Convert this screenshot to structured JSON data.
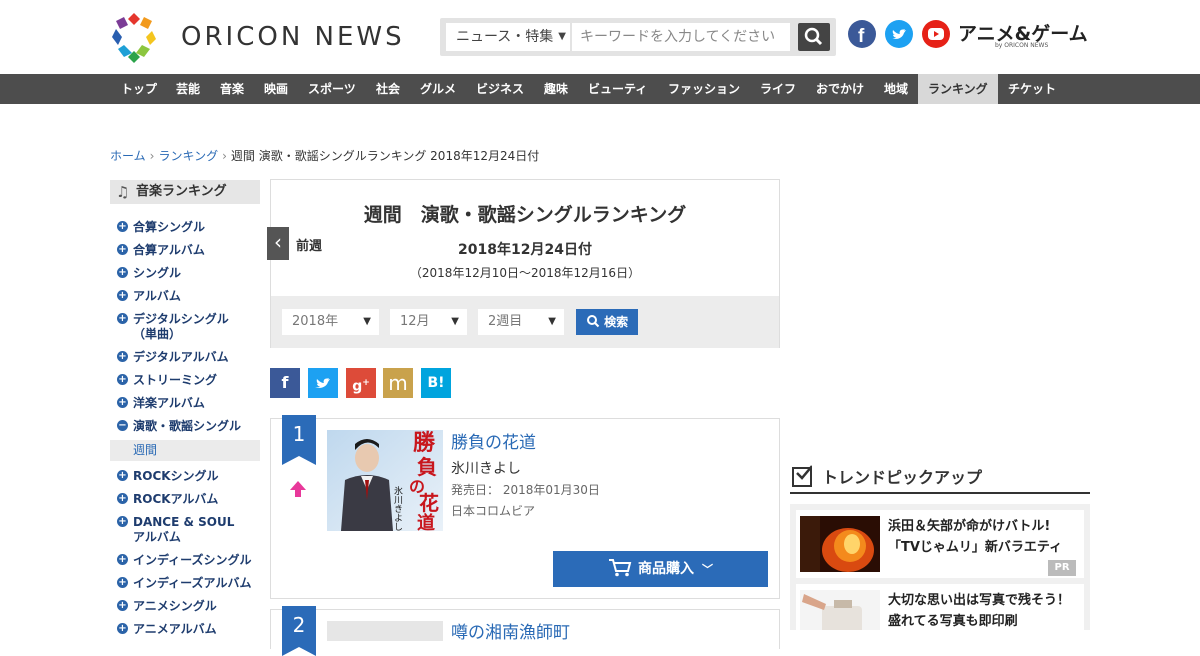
{
  "header": {
    "logo_text": "ORICON NEWS",
    "search_category": "ニュース・特集",
    "search_placeholder": "キーワードを入力してください",
    "anime_logo": "アニメ&ゲーム",
    "anime_sub": "by ORICON NEWS"
  },
  "nav": [
    "トップ",
    "芸能",
    "音楽",
    "映画",
    "スポーツ",
    "社会",
    "グルメ",
    "ビジネス",
    "趣味",
    "ビューティ",
    "ファッション",
    "ライフ",
    "おでかけ",
    "地域",
    "ランキング",
    "チケット"
  ],
  "nav_active": "ランキング",
  "breadcrumb": {
    "home": "ホーム",
    "ranking": "ランキング",
    "current": "週間 演歌・歌謡シングルランキング 2018年12月24日付"
  },
  "sidebar": {
    "title": "音楽ランキング",
    "items": [
      "合算シングル",
      "合算アルバム",
      "シングル",
      "アルバム",
      "デジタルシングル（単曲）",
      "デジタルアルバム",
      "ストリーミング",
      "洋楽アルバム",
      "演歌・歌謡シングル",
      "ROCKシングル",
      "ROCKアルバム",
      "DANCE & SOUL アルバム",
      "インディーズシングル",
      "インディーズアルバム",
      "アニメシングル",
      "アニメアルバム"
    ],
    "sub_item": "週間"
  },
  "ranking": {
    "title": "週間　演歌・歌謡シングルランキング",
    "prev_label": "前週",
    "date": "2018年12月24日付",
    "range": "（2018年12月10日～2018年12月16日）",
    "year_select": "2018年",
    "month_select": "12月",
    "week_select": "2週目",
    "search_button": "検索"
  },
  "entries": [
    {
      "rank": "1",
      "title": "勝負の花道",
      "artist": "氷川きよし",
      "release": "発売日： 2018年01月30日",
      "label": "日本コロムビア",
      "buy_button": "商品購入",
      "jacket_text": "勝負の花道",
      "jacket_artist": "氷川きよし"
    },
    {
      "rank": "2",
      "title": "噂の湘南漁師町"
    }
  ],
  "trend": {
    "title": "トレンドピックアップ",
    "items": [
      {
        "text": "浜田＆矢部が命がけバトル!「TVじゃムリ」新バラエティ",
        "badge": "PR"
      },
      {
        "text": "大切な思い出は写真で残そう！盛れてる写真も即印刷"
      }
    ]
  },
  "colors": {
    "accent": "#2b6bb8",
    "nav_bg": "#4d4d4d",
    "link": "#2a6ab5"
  }
}
